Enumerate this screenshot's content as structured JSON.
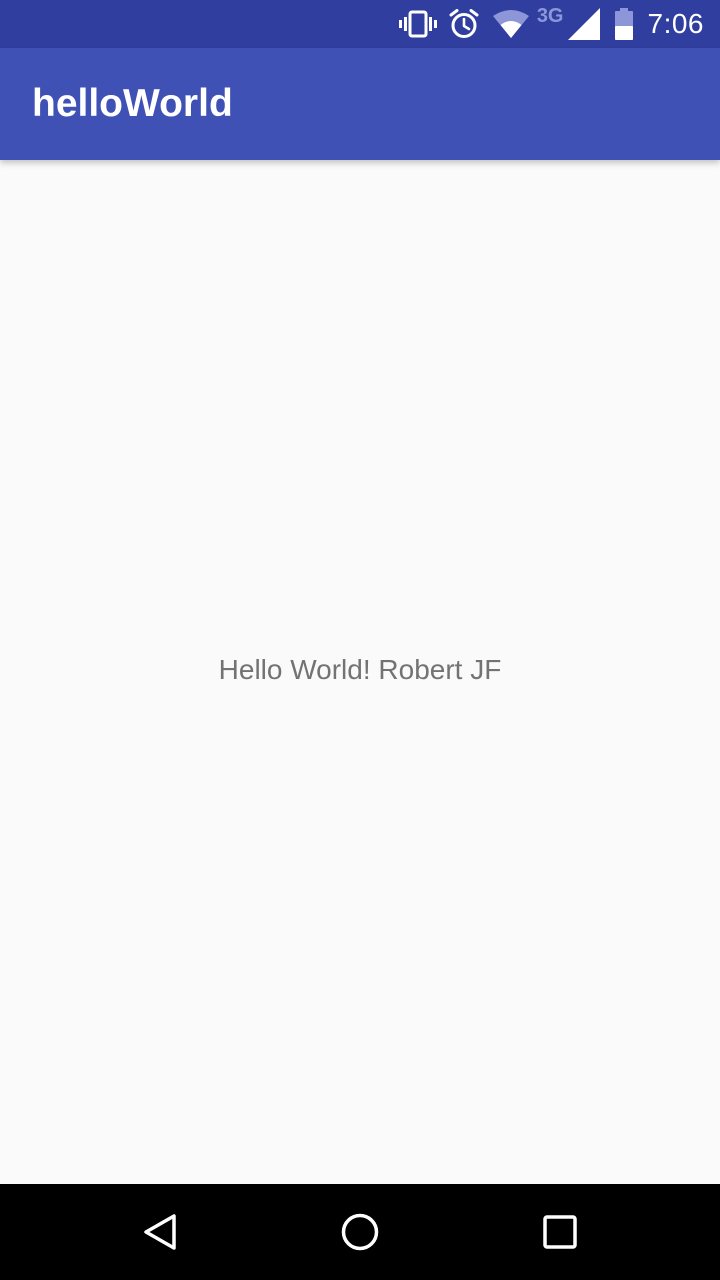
{
  "status_bar": {
    "network": "3G",
    "time": "7:06",
    "icons": [
      "vibrate-icon",
      "alarm-icon",
      "wifi-icon",
      "cellular-signal-icon",
      "battery-icon"
    ]
  },
  "app_bar": {
    "title": "helloWorld"
  },
  "content": {
    "message": "Hello World! Robert JF"
  },
  "nav_bar": {
    "buttons": [
      "back-icon",
      "home-icon",
      "recents-icon"
    ]
  },
  "colors": {
    "status_bar": "#303f9f",
    "primary": "#3f51b5",
    "background": "#fafafa",
    "text_secondary": "#737373",
    "nav_bar": "#000000"
  }
}
